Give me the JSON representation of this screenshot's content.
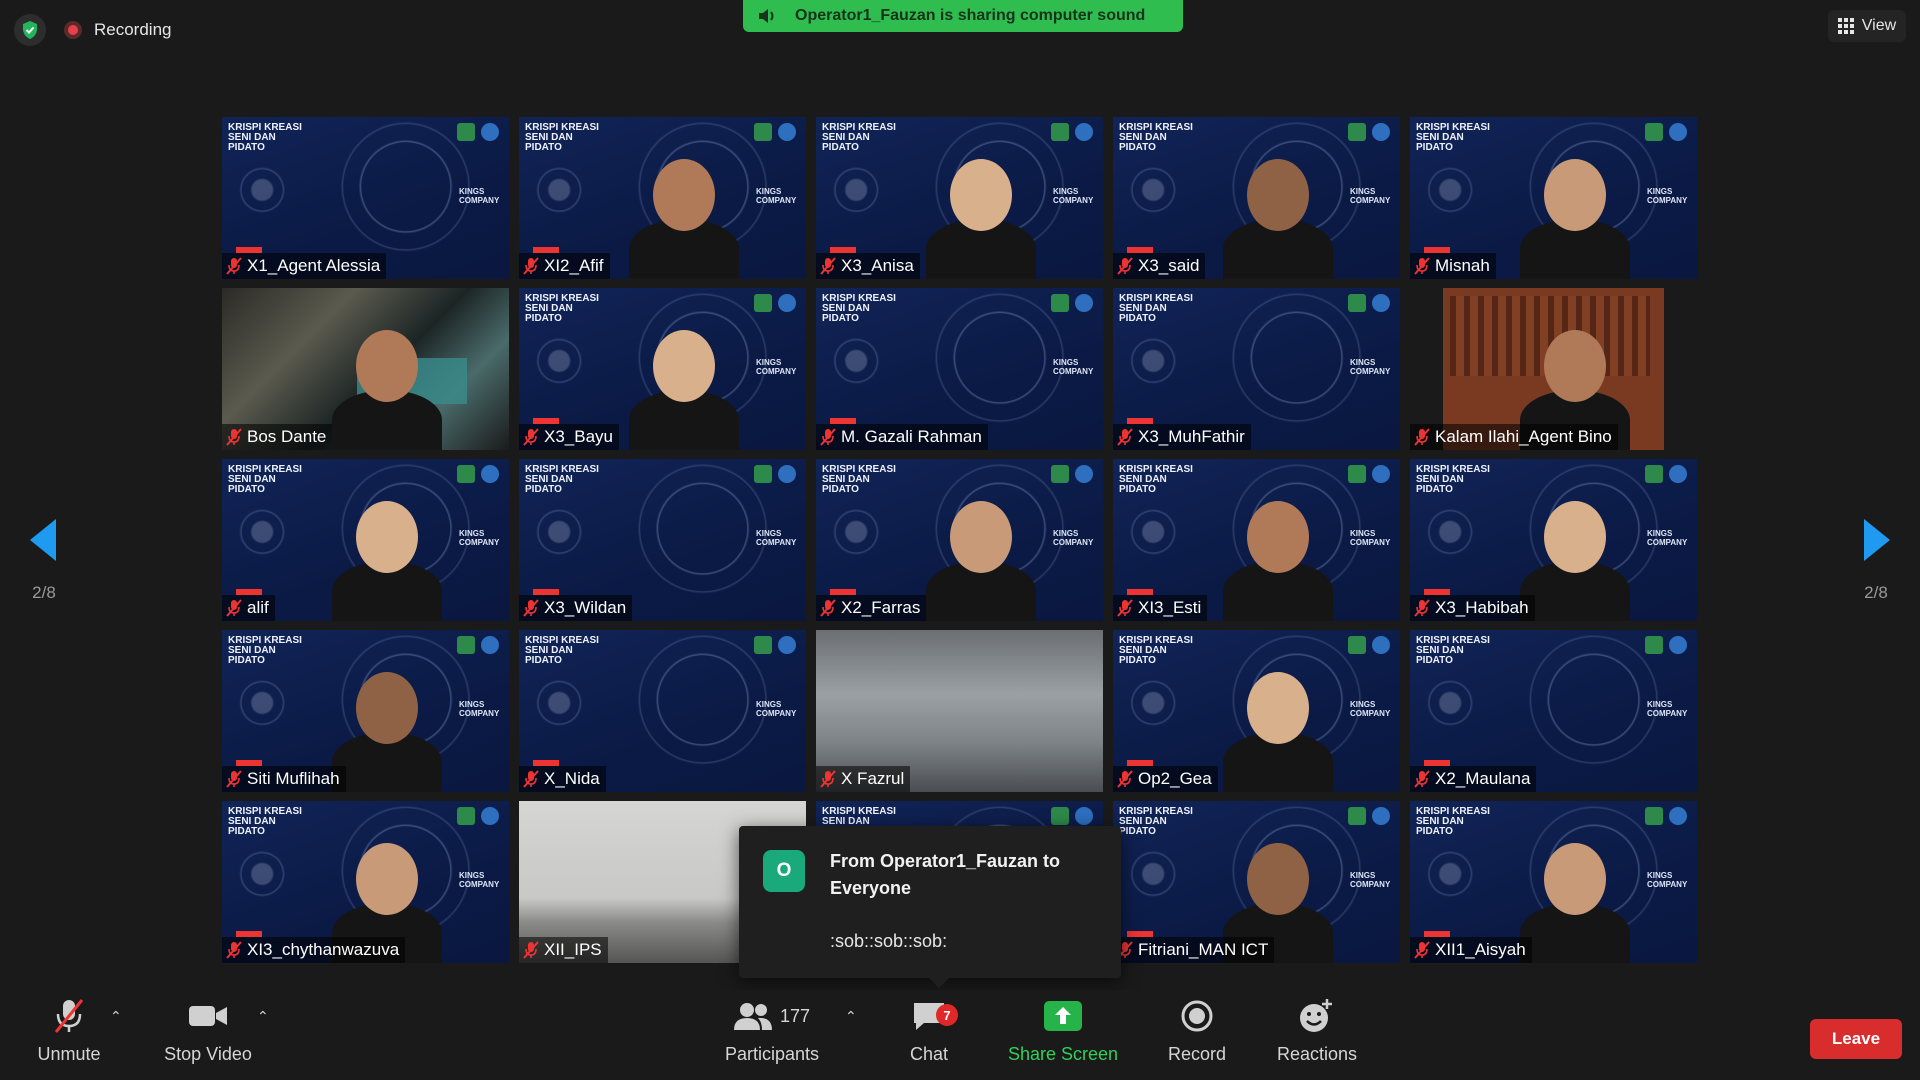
{
  "topbar": {
    "recording_label": "Recording",
    "share_banner": "Operator1_Fauzan is sharing computer sound",
    "view_label": "View"
  },
  "nav": {
    "page_indicator": "2/8"
  },
  "tiles": [
    {
      "name": "X1_Agent Alessia",
      "bg": "blue",
      "person": false
    },
    {
      "name": "XI2_Afif",
      "bg": "blue",
      "person": true
    },
    {
      "name": "X3_Anisa",
      "bg": "blue",
      "person": true
    },
    {
      "name": "X3_said",
      "bg": "blue",
      "person": true
    },
    {
      "name": "Misnah",
      "bg": "blue",
      "person": true
    },
    {
      "name": "Bos Dante",
      "bg": "room",
      "person": true
    },
    {
      "name": "X3_Bayu",
      "bg": "blue",
      "person": true
    },
    {
      "name": "M. Gazali Rahman",
      "bg": "blue",
      "person": false
    },
    {
      "name": "X3_MuhFathir",
      "bg": "blue",
      "person": false
    },
    {
      "name": "Kalam Ilahi_Agent Bino",
      "bg": "wood",
      "person": true
    },
    {
      "name": "alif",
      "bg": "blue",
      "person": true
    },
    {
      "name": "X3_Wildan",
      "bg": "blue",
      "person": false
    },
    {
      "name": "X2_Farras",
      "bg": "blue",
      "person": true
    },
    {
      "name": "XI3_Esti",
      "bg": "blue",
      "person": true
    },
    {
      "name": "X3_Habibah",
      "bg": "blue",
      "person": true
    },
    {
      "name": "Siti Muflihah",
      "bg": "blue",
      "person": true
    },
    {
      "name": "X_Nida",
      "bg": "blue",
      "person": false
    },
    {
      "name": "X Fazrul",
      "bg": "grey",
      "person": false
    },
    {
      "name": "Op2_Gea",
      "bg": "blue",
      "person": true
    },
    {
      "name": "X2_Maulana",
      "bg": "blue",
      "person": false
    },
    {
      "name": "XI3_chythanwazuva",
      "bg": "blue",
      "person": true
    },
    {
      "name": "XII_IPS",
      "bg": "class",
      "person": false
    },
    {
      "name": "",
      "bg": "blue",
      "person": false
    },
    {
      "name": "Fitriani_MAN ICT",
      "bg": "blue",
      "person": true
    },
    {
      "name": "XII1_Aisyah",
      "bg": "blue",
      "person": true
    }
  ],
  "background_text": {
    "krispi": "KRISPI KREASI SENI DAN PIDATO",
    "kings": "KINGS COMPANY"
  },
  "chat_popup": {
    "avatar_letter": "O",
    "from": "From Operator1_Fauzan to Everyone",
    "message": ":sob::sob::sob:"
  },
  "toolbar": {
    "unmute": "Unmute",
    "stop_video": "Stop Video",
    "participants_count": "177",
    "participants": "Participants",
    "chat": "Chat",
    "chat_badge": "7",
    "share_screen": "Share Screen",
    "record": "Record",
    "reactions": "Reactions",
    "leave": "Leave"
  },
  "colors": {
    "share_green": "#2fbd4f",
    "leave_red": "#d92d2d",
    "nav_blue": "#1e9bf0",
    "chat_avatar": "#1aa97a"
  }
}
